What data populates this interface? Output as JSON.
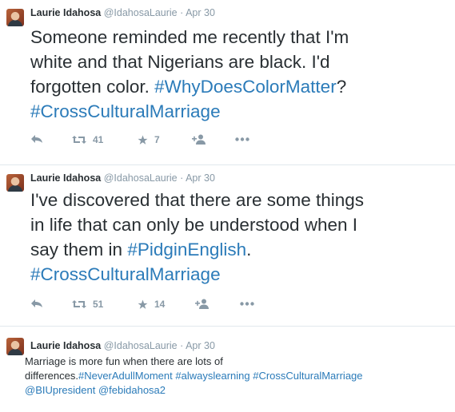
{
  "tweets": [
    {
      "name": "Laurie Idahosa",
      "handle": "@IdahosaLaurie",
      "separator": "·",
      "date": "Apr 30",
      "text_lines": [
        {
          "plain": "Someone reminded me recently that I'm"
        },
        {
          "plain": "white and that Nigerians are black. I'd"
        },
        {
          "plain": "forgotten color. ",
          "tag": "#WhyDoesColorMatter",
          "after": "?"
        },
        {
          "tag": "#CrossCulturalMarriage"
        }
      ],
      "retweets": "41",
      "favorites": "7"
    },
    {
      "name": "Laurie Idahosa",
      "handle": "@IdahosaLaurie",
      "separator": "·",
      "date": "Apr 30",
      "text_lines": [
        {
          "plain": "I've discovered that there are some things"
        },
        {
          "plain": "in life that can only be understood when I"
        },
        {
          "plain": "say them in ",
          "tag": "#PidginEnglish",
          "after": "."
        },
        {
          "tag": "#CrossCulturalMarriage"
        }
      ],
      "retweets": "51",
      "favorites": "14"
    },
    {
      "name": "Laurie Idahosa",
      "handle": "@IdahosaLaurie",
      "separator": "·",
      "date": "Apr 30",
      "text_lines": [
        {
          "plain": "Marriage is more fun when there are lots of"
        },
        {
          "plain": "differences.",
          "tag": "#NeverAdullMoment",
          "after": " ",
          "tag2": "#alwayslearning",
          "after2": " ",
          "tag3": "#CrossCulturalMarriage"
        },
        {
          "tag": "@BIUpresident",
          "after": " ",
          "tag2": "@febidahosa2"
        }
      ]
    }
  ],
  "colors": {
    "link": "#2b7bb9",
    "meta": "#8899a6",
    "text": "#292f33",
    "divider": "#e1e8ed"
  },
  "icons": [
    "reply-icon",
    "retweet-icon",
    "favorite-icon",
    "follow-icon",
    "more-icon"
  ]
}
